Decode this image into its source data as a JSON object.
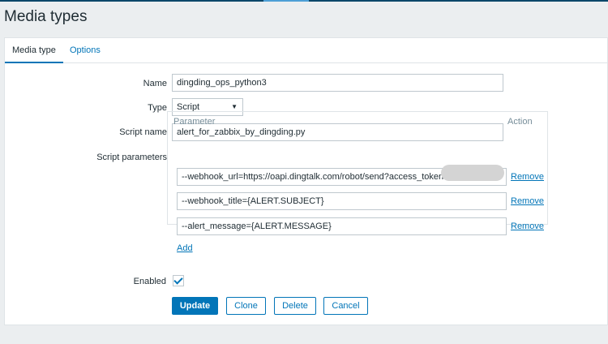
{
  "page": {
    "title": "Media types"
  },
  "tabs": [
    {
      "label": "Media type",
      "active": true
    },
    {
      "label": "Options",
      "active": false
    }
  ],
  "form": {
    "name_label": "Name",
    "name_value": "dingding_ops_python3",
    "type_label": "Type",
    "type_value": "Script",
    "script_name_label": "Script name",
    "script_name_value": "alert_for_zabbix_by_dingding.py",
    "script_params_label": "Script parameters",
    "params_header_parameter": "Parameter",
    "params_header_action": "Action",
    "params": [
      {
        "value": "--webhook_url=https://oapi.dingtalk.com/robot/send?access_token=",
        "action": "Remove"
      },
      {
        "value": "--webhook_title={ALERT.SUBJECT}",
        "action": "Remove"
      },
      {
        "value": "--alert_message={ALERT.MESSAGE}",
        "action": "Remove"
      }
    ],
    "add_label": "Add",
    "enabled_label": "Enabled",
    "enabled_checked": true
  },
  "buttons": {
    "update": "Update",
    "clone": "Clone",
    "delete": "Delete",
    "cancel": "Cancel"
  },
  "colors": {
    "accent": "#0275b8",
    "header_bar": "#0a466a"
  }
}
